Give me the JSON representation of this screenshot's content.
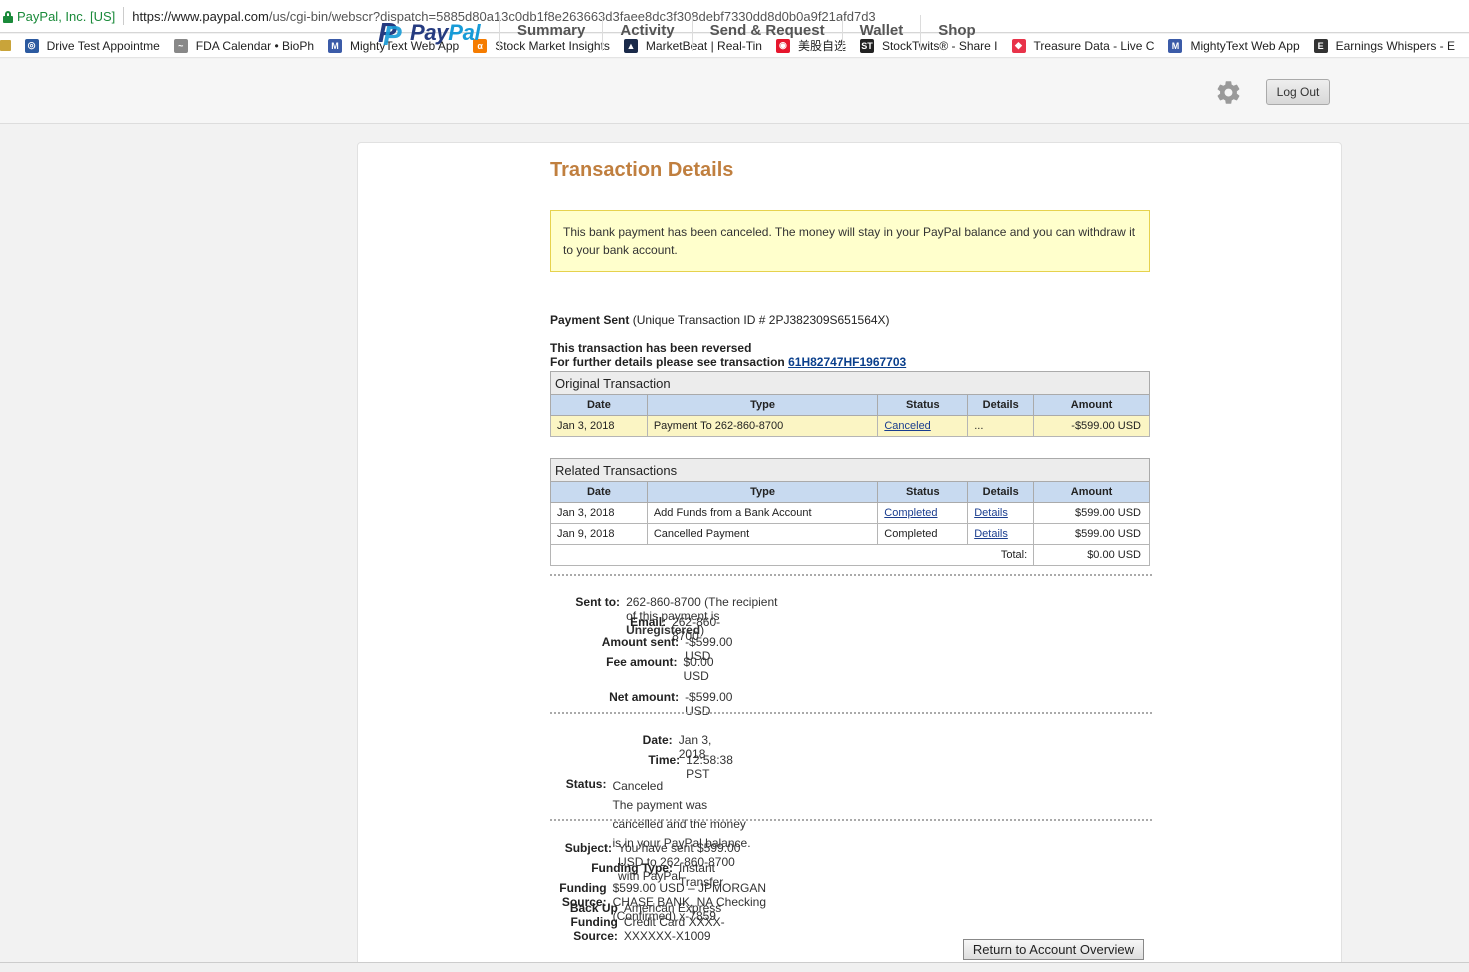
{
  "browser": {
    "site_identity": "PayPal, Inc. [US]",
    "url_host": "https://www.paypal.com",
    "url_path": "/us/cgi-bin/webscr?dispatch=5885d80a13c0db1f8e263663d3faee8dc3f308debf7330dd8d0b0a9f21afd7d3",
    "bookmarks": [
      {
        "label": "Drive Test Appointme",
        "icon": "globe-icon",
        "color": "#2c5aa0"
      },
      {
        "label": "FDA Calendar • BioPh",
        "icon": "chart-icon",
        "color": "#888888"
      },
      {
        "label": "MightyText Web App",
        "icon": "mightytext-icon",
        "color": "#3b5ba8"
      },
      {
        "label": "Stock Market Insights",
        "icon": "alpha-icon",
        "color": "#f57c00"
      },
      {
        "label": "MarketBeat | Real-Tin",
        "icon": "marketbeat-icon",
        "color": "#1a2a4a"
      },
      {
        "label": "美股自选",
        "icon": "weibo-icon",
        "color": "#e6162d"
      },
      {
        "label": "StockTwits® - Share I",
        "icon": "stocktwits-icon",
        "color": "#222222"
      },
      {
        "label": "Treasure Data - Live C",
        "icon": "gem-icon",
        "color": "#e8334a"
      },
      {
        "label": "MightyText Web App",
        "icon": "mightytext-icon",
        "color": "#3b5ba8"
      },
      {
        "label": "Earnings Whispers - E",
        "icon": "ew-icon",
        "color": "#333333"
      }
    ]
  },
  "header": {
    "logo_pay": "Pay",
    "logo_pal": "Pal",
    "nav": [
      "Summary",
      "Activity",
      "Send & Request",
      "Wallet",
      "Shop"
    ],
    "logout": "Log Out"
  },
  "page": {
    "title": "Transaction Details",
    "notice": "This bank payment has been canceled. The money will stay in your PayPal balance and you can withdraw it to your bank account.",
    "payment_label": "Payment Sent",
    "payment_id_text": "(Unique Transaction ID # 2PJ382309S651564X)",
    "reversed_line1": "This transaction has been reversed",
    "reversed_line2": "For further details please see transaction",
    "reversed_link": "61H82747HF1967703"
  },
  "original": {
    "caption": "Original Transaction",
    "columns": [
      "Date",
      "Type",
      "Status",
      "Details",
      "Amount"
    ],
    "row": {
      "date": "Jan 3, 2018",
      "type": "Payment To 262-860-8700",
      "status": "Canceled",
      "details": "...",
      "amount": "-$599.00 USD"
    }
  },
  "related": {
    "caption": "Related Transactions",
    "columns": [
      "Date",
      "Type",
      "Status",
      "Details",
      "Amount"
    ],
    "rows": [
      {
        "date": "Jan 3, 2018",
        "type": "Add Funds from a Bank Account",
        "status": "Completed",
        "details": "Details",
        "amount": "$599.00 USD"
      },
      {
        "date": "Jan 9, 2018",
        "type": "Cancelled Payment",
        "status": "Completed",
        "details": "Details",
        "amount": "$599.00 USD"
      }
    ],
    "total_label": "Total:",
    "total": "$0.00 USD"
  },
  "summary": {
    "sent_to_label": "Sent to:",
    "sent_to_value": "262-860-8700 (The recipient of this payment is ",
    "sent_to_bold": "Unregistered",
    "sent_to_end": ")",
    "email_label": "Email:",
    "email_value": "262-860-8700",
    "amount_label": "Amount sent:",
    "amount_value": "-$599.00 USD",
    "fee_label": "Fee amount:",
    "fee_value": "$0.00 USD",
    "net_label": "Net amount:",
    "net_value": "-$599.00 USD"
  },
  "timing": {
    "date_label": "Date:",
    "date_value": "Jan 3, 2018",
    "time_label": "Time:",
    "time_value": "12:58:38 PST",
    "status_label": "Status:",
    "status_value": "Canceled",
    "status_note": "The payment was cancelled and the money is in your PayPal balance."
  },
  "funding": {
    "subject_label": "Subject:",
    "subject_value": "You have sent $599.00 USD to 262-860-8700 with PayPal",
    "type_label": "Funding Type:",
    "type_value": "Instant Transfer",
    "source_label": "Funding Source:",
    "source_value": "$599.00 USD – JPMORGAN CHASE BANK, NA Checking (Confirmed) x-7859",
    "backup_label": "Back Up Funding Source:",
    "backup_value": "American Express Credit Card XXXX-XXXXXX-X1009"
  },
  "return_button": "Return to Account Overview"
}
